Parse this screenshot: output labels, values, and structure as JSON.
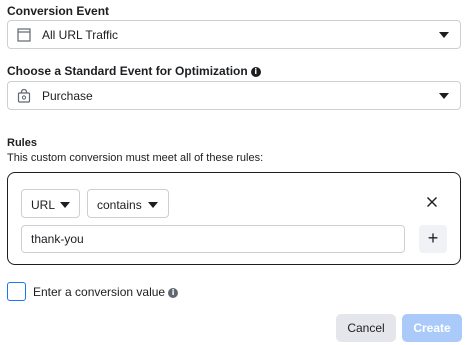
{
  "conversion_event": {
    "label": "Conversion Event",
    "value": "All URL Traffic"
  },
  "standard_event": {
    "label": "Choose a Standard Event for Optimization",
    "value": "Purchase"
  },
  "rules": {
    "title": "Rules",
    "subtitle": "This custom conversion must meet all of these rules:",
    "field_select": "URL",
    "operator_select": "contains",
    "value_input": "thank-you"
  },
  "conversion_value": {
    "label": "Enter a conversion value",
    "checked": false
  },
  "actions": {
    "cancel_label": "Cancel",
    "create_label": "Create"
  },
  "colors": {
    "accent": "#1877f2",
    "create_disabled": "#aacbf9",
    "secondary_button": "#e4e6eb"
  }
}
